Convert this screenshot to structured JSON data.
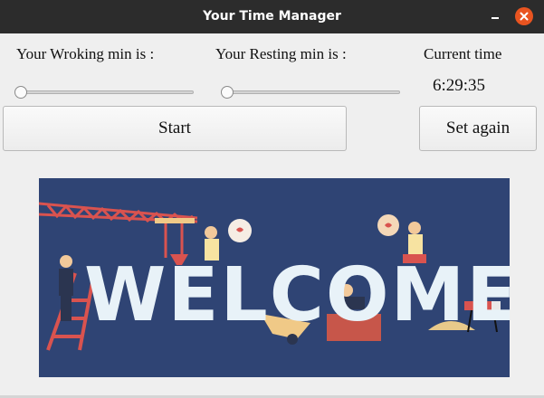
{
  "window": {
    "title": "Your Time Manager",
    "minimize_icon": "minimize-icon",
    "close_icon": "close-icon",
    "close_color": "#e95420"
  },
  "controls": {
    "working_label": "Your Wroking min is :",
    "resting_label": "Your Resting min is :",
    "current_time_label": "Current time",
    "current_time_value": "6:29:35",
    "working_slider_value": 0,
    "resting_slider_value": 0
  },
  "buttons": {
    "start_label": "Start",
    "set_again_label": "Set again"
  },
  "banner": {
    "text": "WELCOME",
    "background_color": "#2f4474"
  }
}
